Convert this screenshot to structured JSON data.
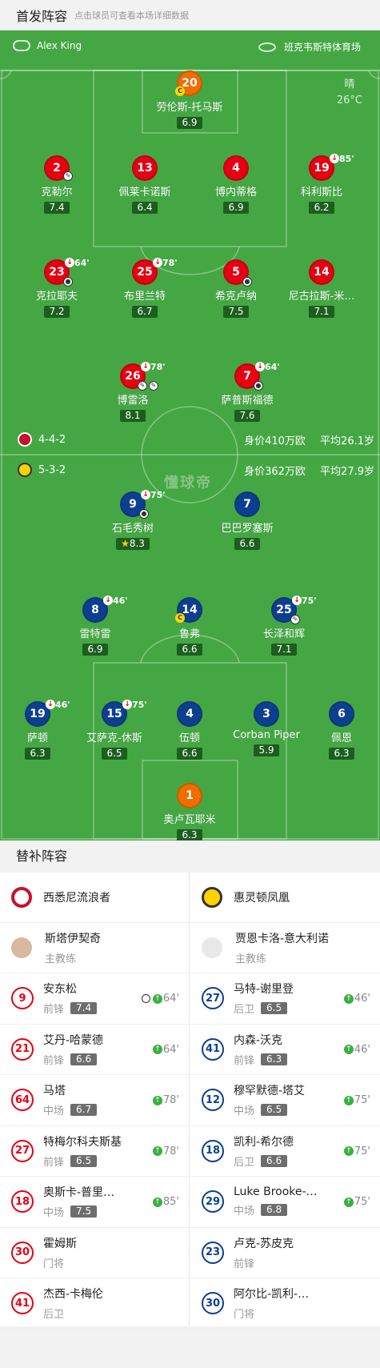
{
  "header": {
    "title": "首发阵容",
    "subtitle": "点击球员可查看本场详细数据"
  },
  "pitch": {
    "referee": "Alex King",
    "venue": "班克韦斯特体育场",
    "weather": "晴",
    "temperature": "26°C",
    "watermark": "懂球帝",
    "home": {
      "formation": "4-4-2",
      "value": "身价410万欧",
      "avg_age": "平均26.1岁"
    },
    "away": {
      "formation": "5-3-2",
      "value": "身价362万欧",
      "avg_age": "平均27.9岁"
    },
    "home_players": [
      {
        "num": "20",
        "name": "劳伦斯-托马斯",
        "rating": "6.9"
      },
      {
        "num": "2",
        "name": "克勒尔",
        "rating": "7.4"
      },
      {
        "num": "13",
        "name": "佩莱卡诺斯",
        "rating": "6.4"
      },
      {
        "num": "4",
        "name": "博内蒂格",
        "rating": "6.9"
      },
      {
        "num": "19",
        "name": "科利斯比",
        "rating": "6.2",
        "sub": "85'"
      },
      {
        "num": "23",
        "name": "克拉耶夫",
        "rating": "7.2",
        "sub": "64'"
      },
      {
        "num": "25",
        "name": "布里兰特",
        "rating": "6.7",
        "sub": "78'"
      },
      {
        "num": "5",
        "name": "希克卢纳",
        "rating": "7.5"
      },
      {
        "num": "14",
        "name": "尼古拉斯-米…",
        "rating": "7.1"
      },
      {
        "num": "26",
        "name": "博雷洛",
        "rating": "8.1",
        "sub": "78'"
      },
      {
        "num": "7",
        "name": "萨普斯福德",
        "rating": "7.6",
        "sub": "64'"
      }
    ],
    "away_players": [
      {
        "num": "9",
        "name": "石毛秀树",
        "rating": "8.3",
        "sub": "75'"
      },
      {
        "num": "7",
        "name": "巴巴罗塞斯",
        "rating": "6.6"
      },
      {
        "num": "8",
        "name": "雷特雷",
        "rating": "6.9",
        "sub": "46'"
      },
      {
        "num": "14",
        "name": "鲁弗",
        "rating": "6.6"
      },
      {
        "num": "25",
        "name": "长泽和辉",
        "rating": "7.1",
        "sub": "75'"
      },
      {
        "num": "19",
        "name": "萨顿",
        "rating": "6.3",
        "sub": "46'"
      },
      {
        "num": "15",
        "name": "艾萨克-休斯",
        "rating": "6.5",
        "sub": "75'"
      },
      {
        "num": "4",
        "name": "伍顿",
        "rating": "6.6"
      },
      {
        "num": "3",
        "name": "Corban Piper",
        "rating": "5.9"
      },
      {
        "num": "6",
        "name": "佩恩",
        "rating": "6.3"
      },
      {
        "num": "1",
        "name": "奥卢瓦耶米",
        "rating": "6.3"
      }
    ]
  },
  "subs": {
    "title": "替补阵容",
    "home_team": "西悉尼流浪者",
    "away_team": "惠灵顿凤凰",
    "home_coach": {
      "name": "斯塔伊契奇",
      "role": "主教练"
    },
    "away_coach": {
      "name": "贾恩卡洛-意大利诺",
      "role": "主教练"
    },
    "home": [
      {
        "num": "9",
        "name": "安东松",
        "pos": "前锋",
        "rating": "7.4",
        "in": "64'"
      },
      {
        "num": "21",
        "name": "艾丹-哈蒙德",
        "pos": "前锋",
        "rating": "6.6",
        "in": "64'"
      },
      {
        "num": "64",
        "name": "马塔",
        "pos": "中场",
        "rating": "6.7",
        "in": "78'"
      },
      {
        "num": "27",
        "name": "特梅尔科夫斯基",
        "pos": "前锋",
        "rating": "6.5",
        "in": "78'"
      },
      {
        "num": "18",
        "name": "奥斯卡-普里…",
        "pos": "中场",
        "rating": "7.5",
        "in": "85'"
      },
      {
        "num": "30",
        "name": "霍姆斯",
        "pos": "门将"
      },
      {
        "num": "41",
        "name": "杰西-卡梅伦",
        "pos": "后卫"
      }
    ],
    "away": [
      {
        "num": "27",
        "name": "马特-谢里登",
        "pos": "后卫",
        "rating": "6.5",
        "in": "46'"
      },
      {
        "num": "41",
        "name": "内森-沃克",
        "pos": "前锋",
        "rating": "6.3",
        "in": "46'"
      },
      {
        "num": "12",
        "name": "穆罕默德-塔艾",
        "pos": "中场",
        "rating": "6.5",
        "in": "75'"
      },
      {
        "num": "18",
        "name": "凯利-希尔德",
        "pos": "后卫",
        "rating": "6.6",
        "in": "75'"
      },
      {
        "num": "29",
        "name": "Luke Brooke-…",
        "pos": "中场",
        "rating": "6.8",
        "in": "75'"
      },
      {
        "num": "23",
        "name": "卢克-苏皮克",
        "pos": "前锋"
      },
      {
        "num": "30",
        "name": "阿尔比-凯利-…",
        "pos": "门将"
      }
    ]
  }
}
